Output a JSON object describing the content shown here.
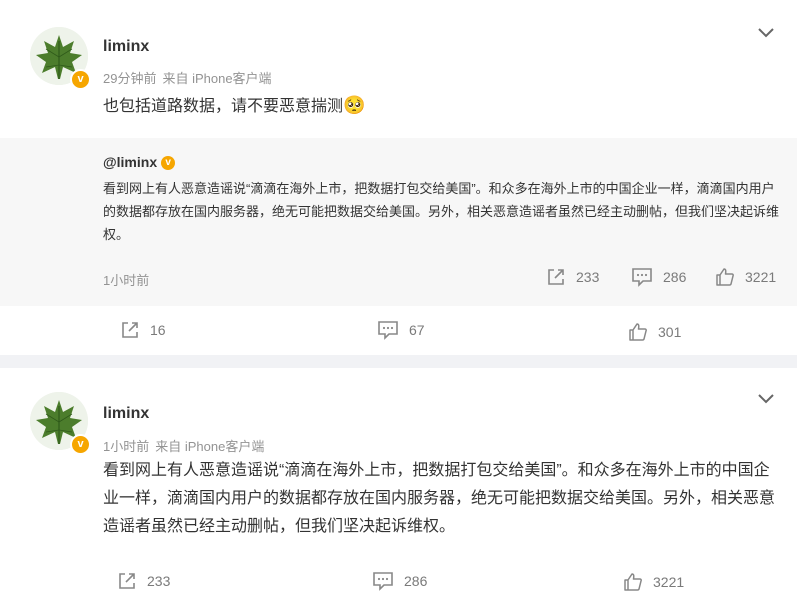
{
  "post1": {
    "username": "liminx",
    "time": "29分钟前",
    "source": "来自 iPhone客户端",
    "text": "也包括道路数据，请不要恶意揣测",
    "emoji": "🥺",
    "quoted": {
      "username": "@liminx",
      "text": "看到网上有人恶意造谣说“滴滴在海外上市，把数据打包交给美国”。和众多在海外上市的中国企业一样，滴滴国内用户的数据都存放在国内服务器，绝无可能把数据交给美国。另外，相关恶意造谣者虽然已经主动删帖，但我们坚决起诉维权。",
      "time": "1小时前",
      "reposts": "233",
      "comments": "286",
      "likes": "3221"
    },
    "reposts": "16",
    "comments": "67",
    "likes": "301"
  },
  "post2": {
    "username": "liminx",
    "time": "1小时前",
    "source": "来自 iPhone客户端",
    "text": "看到网上有人恶意造谣说“滴滴在海外上市，把数据打包交给美国”。和众多在海外上市的中国企业一样，滴滴国内用户的数据都存放在国内服务器，绝无可能把数据交给美国。另外，相关恶意造谣者虽然已经主动删帖，但我们坚决起诉维权。",
    "reposts": "233",
    "comments": "286",
    "likes": "3221"
  },
  "icons": {
    "verified": "verified-badge",
    "chevron": "chevron-down-icon",
    "repost": "repost-icon",
    "comment": "comment-icon",
    "like": "like-icon"
  },
  "colors": {
    "verified": "#f6a600",
    "page_bg": "#f1f2f5",
    "quote_bg": "#f7f7f7",
    "muted": "#939393"
  }
}
